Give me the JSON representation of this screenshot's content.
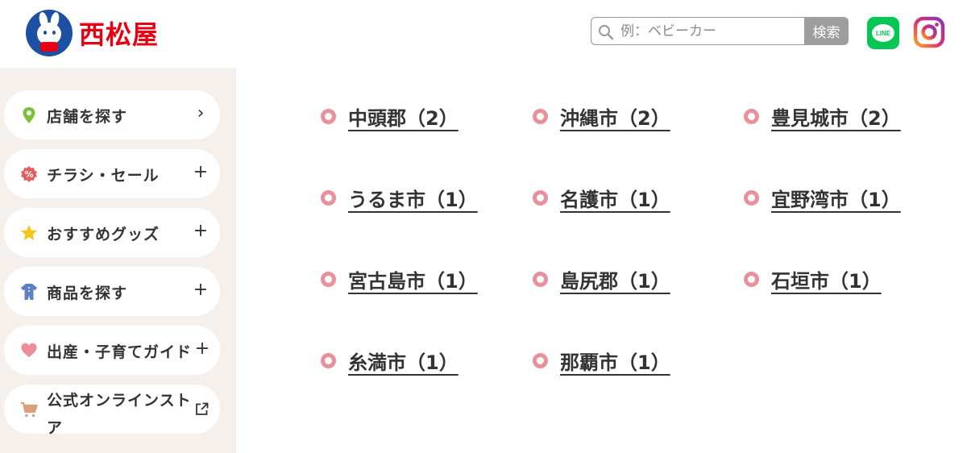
{
  "header": {
    "logo_text": "西松屋",
    "search": {
      "placeholder": "例：ベビーカー",
      "value": "",
      "button_label": "検索"
    },
    "sns": {
      "line_label": "LINE"
    }
  },
  "sidebar": {
    "items": [
      {
        "label": "店舗を探す",
        "action": "›",
        "icon": "location-pin-icon"
      },
      {
        "label": "チラシ・セール",
        "action": "+",
        "icon": "percent-badge-icon"
      },
      {
        "label": "おすすめグッズ",
        "action": "+",
        "icon": "star-icon"
      },
      {
        "label": "商品を探す",
        "action": "+",
        "icon": "baby-clothes-icon"
      },
      {
        "label": "出産・子育てガイド",
        "action": "+",
        "icon": "heart-icon"
      },
      {
        "label": "公式オンラインストア",
        "action": "",
        "icon": "cart-icon"
      }
    ]
  },
  "cities": [
    "中頭郡（2）",
    "沖縄市（2）",
    "豊見城市（2）",
    "うるま市（1）",
    "名護市（1）",
    "宜野湾市（1）",
    "宮古島市（1）",
    "島尻郡（1）",
    "石垣市（1）",
    "糸満市（1）",
    "那覇市（1）"
  ],
  "colors": {
    "brand_red": "#e60012",
    "brand_blue": "#1d4fa3",
    "sidebar_bg": "#f5f0eb",
    "marker_pink": "#e8919c",
    "line_green": "#06c755"
  }
}
